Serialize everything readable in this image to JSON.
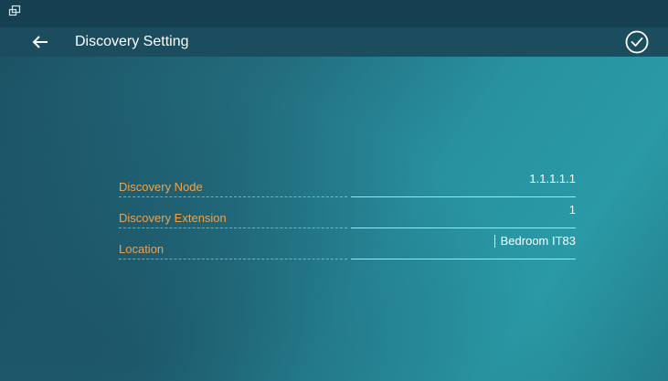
{
  "appbar": {
    "title": "Discovery Setting"
  },
  "icons": {
    "status": "window-restore-icon",
    "back": "back-arrow-icon",
    "confirm": "check-circle-icon"
  },
  "colors": {
    "label": "#f0a24a",
    "value": "#ffffff",
    "statusbar": "#173f52",
    "appbar": "#1c4d5f"
  },
  "form": {
    "fields": [
      {
        "label": "Discovery Node",
        "value": "1.1.1.1.1"
      },
      {
        "label": "Discovery Extension",
        "value": "1"
      },
      {
        "label": "Location",
        "value": "Bedroom IT83"
      }
    ]
  }
}
